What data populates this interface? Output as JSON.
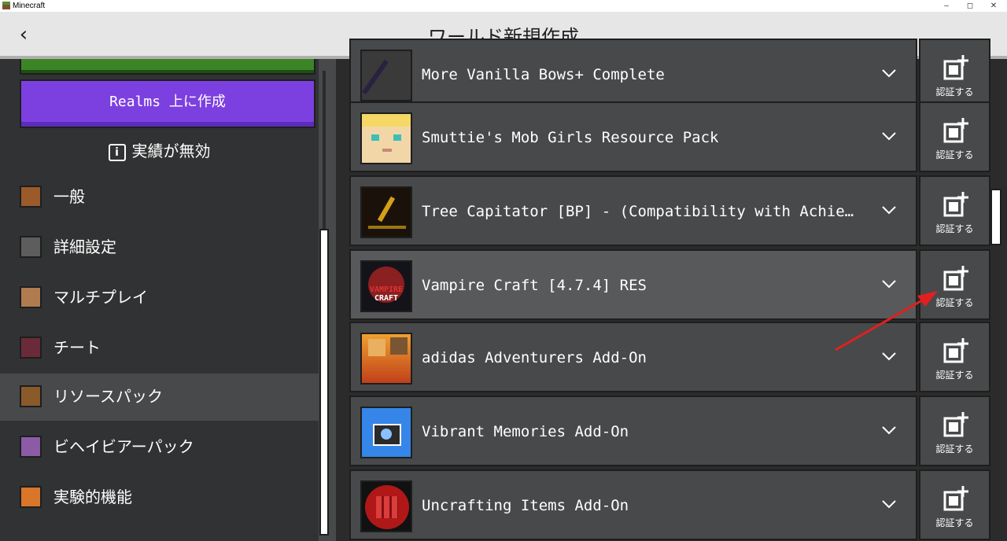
{
  "window": {
    "title": "Minecraft",
    "minimize": "–",
    "restore": "◻",
    "close": "✕"
  },
  "header": {
    "back_icon": "‹",
    "title": "ワールド新規作成"
  },
  "left": {
    "realms_button": "Realms 上に作成",
    "achievements": {
      "icon": "i",
      "text": "実績が無効"
    },
    "nav": [
      {
        "label": "一般",
        "icon": "gear-icon",
        "color": "#9b5a2a",
        "selected": false
      },
      {
        "label": "詳細設定",
        "icon": "furnace-icon",
        "color": "#5d5d5d",
        "selected": false
      },
      {
        "label": "マルチプレイ",
        "icon": "steve-icon",
        "color": "#b07b4f",
        "selected": false
      },
      {
        "label": "チート",
        "icon": "command-block-icon",
        "color": "#6b2a3a",
        "selected": false
      },
      {
        "label": "リソースパック",
        "icon": "chest-icon",
        "color": "#8a5a2b",
        "selected": true
      },
      {
        "label": "ビヘイビアーパック",
        "icon": "purple-block-icon",
        "color": "#8c5ba5",
        "selected": false
      },
      {
        "label": "実験的機能",
        "icon": "experiment-icon",
        "color": "#d9762a",
        "selected": false
      }
    ]
  },
  "packs": [
    {
      "name": "More Vanilla Bows+ Complete",
      "icon": "bow-icon",
      "action": "認証する",
      "hover": false
    },
    {
      "name": "Smuttie's Mob Girls Resource Pack",
      "icon": "blonde-face-icon",
      "action": "認証する",
      "hover": false
    },
    {
      "name": "Tree Capitator [BP] - (Compatibility with Achieveme...",
      "icon": "golden-axe-icon",
      "action": "認証する",
      "hover": false
    },
    {
      "name": "Vampire Craft [4.7.4] RES",
      "icon": "vampire-craft-icon",
      "icon_text": [
        "VAMPIRE",
        "CRAFT"
      ],
      "action": "認証する",
      "hover": true
    },
    {
      "name": "adidas Adventurers Add-On",
      "icon": "adidas-icon",
      "action": "認証する",
      "hover": false
    },
    {
      "name": "Vibrant Memories Add-On",
      "icon": "camera-icon",
      "action": "認証する",
      "hover": false
    },
    {
      "name": "Uncrafting Items Add-On",
      "icon": "crafting-grid-icon",
      "action": "認証する",
      "hover": false
    }
  ],
  "colors": {
    "accent_purple": "#7d40e0",
    "accent_green": "#3c8527",
    "arrow_red": "#e02020"
  }
}
